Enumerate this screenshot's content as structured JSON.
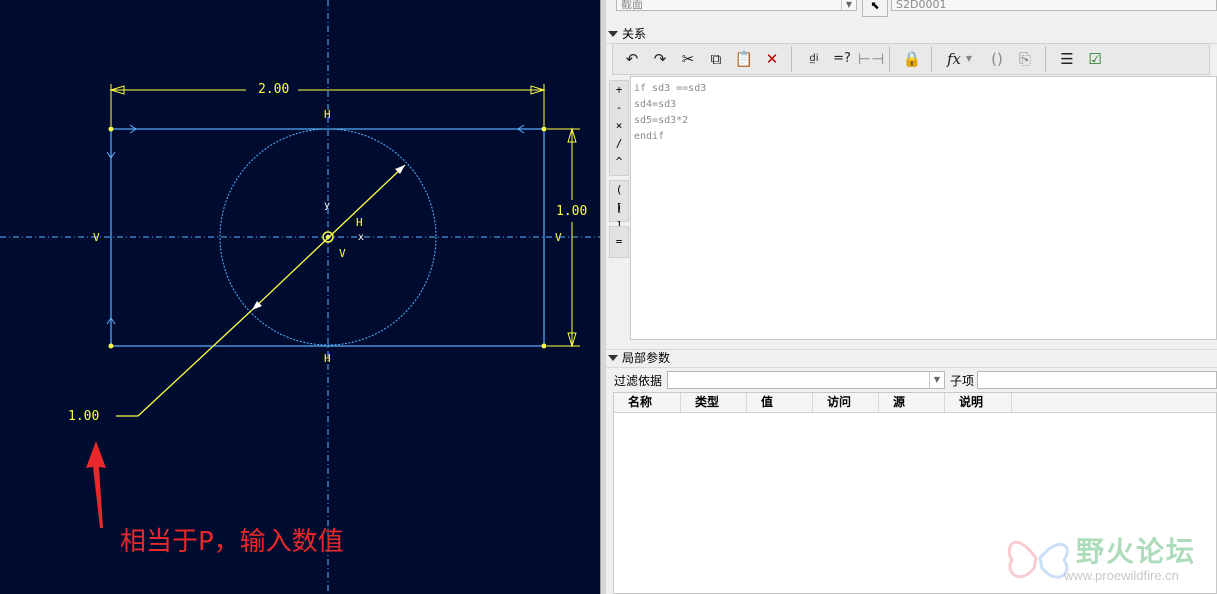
{
  "sketch": {
    "dim_width": "2.00",
    "dim_height": "1.00",
    "dim_diameter": "1.00",
    "constraint_h": "H",
    "constraint_v": "V",
    "axis_y": "y",
    "axis_x": "x",
    "note": "相当于P，输入数值",
    "colors": {
      "background": "#000b30",
      "geometry": "#5ab4ff",
      "dimension": "#ffff40",
      "annotation": "#e8292b"
    }
  },
  "panel": {
    "section_combo": "截面",
    "sketch_name": "S2D0001",
    "relations_header": "关系",
    "toolbar_icons": [
      "undo-icon",
      "redo-icon",
      "cut-icon",
      "copy-icon",
      "paste-icon",
      "delete-icon",
      "evaluate-icon",
      "verify-icon",
      "sort-icon",
      "lock-icon",
      "function-icon",
      "parentheses-icon",
      "insert-icon",
      "list-icon",
      "checkbox-icon"
    ],
    "operators": [
      "+",
      "-",
      "×",
      "/",
      "^",
      "( )",
      "[ ]",
      "="
    ],
    "relations": [
      "if sd3 ==sd3",
      "sd4=sd3",
      "sd5=sd3*2",
      "endif"
    ],
    "local_params_header": "局部参数",
    "filter_label": "过滤依据",
    "filter_value": "",
    "sub_label": "子项",
    "sub_value": "",
    "columns": [
      "名称",
      "类型",
      "值",
      "访问",
      "源",
      "说明"
    ]
  },
  "watermark": {
    "title": "野火论坛",
    "url": "www.proewildfire.cn"
  }
}
